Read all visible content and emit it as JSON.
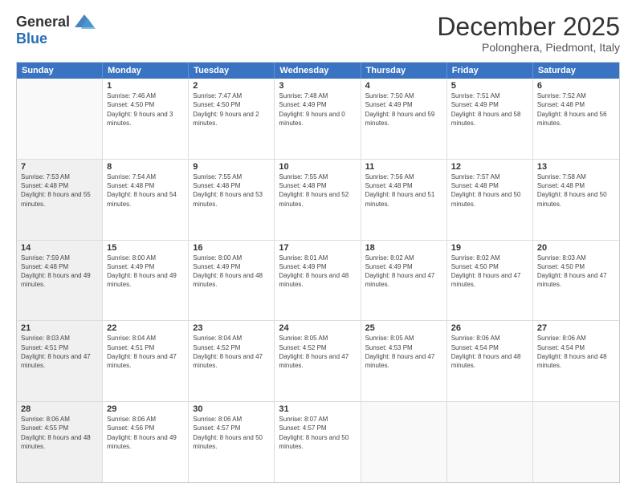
{
  "logo": {
    "general": "General",
    "blue": "Blue"
  },
  "header": {
    "month": "December 2025",
    "location": "Polonghera, Piedmont, Italy"
  },
  "days": [
    "Sunday",
    "Monday",
    "Tuesday",
    "Wednesday",
    "Thursday",
    "Friday",
    "Saturday"
  ],
  "weeks": [
    [
      {
        "day": "",
        "sunrise": "",
        "sunset": "",
        "daylight": "",
        "empty": true
      },
      {
        "day": "1",
        "sunrise": "Sunrise: 7:46 AM",
        "sunset": "Sunset: 4:50 PM",
        "daylight": "Daylight: 9 hours and 3 minutes."
      },
      {
        "day": "2",
        "sunrise": "Sunrise: 7:47 AM",
        "sunset": "Sunset: 4:50 PM",
        "daylight": "Daylight: 9 hours and 2 minutes."
      },
      {
        "day": "3",
        "sunrise": "Sunrise: 7:48 AM",
        "sunset": "Sunset: 4:49 PM",
        "daylight": "Daylight: 9 hours and 0 minutes."
      },
      {
        "day": "4",
        "sunrise": "Sunrise: 7:50 AM",
        "sunset": "Sunset: 4:49 PM",
        "daylight": "Daylight: 8 hours and 59 minutes."
      },
      {
        "day": "5",
        "sunrise": "Sunrise: 7:51 AM",
        "sunset": "Sunset: 4:49 PM",
        "daylight": "Daylight: 8 hours and 58 minutes."
      },
      {
        "day": "6",
        "sunrise": "Sunrise: 7:52 AM",
        "sunset": "Sunset: 4:48 PM",
        "daylight": "Daylight: 8 hours and 56 minutes."
      }
    ],
    [
      {
        "day": "7",
        "sunrise": "Sunrise: 7:53 AM",
        "sunset": "Sunset: 4:48 PM",
        "daylight": "Daylight: 8 hours and 55 minutes.",
        "shaded": true
      },
      {
        "day": "8",
        "sunrise": "Sunrise: 7:54 AM",
        "sunset": "Sunset: 4:48 PM",
        "daylight": "Daylight: 8 hours and 54 minutes."
      },
      {
        "day": "9",
        "sunrise": "Sunrise: 7:55 AM",
        "sunset": "Sunset: 4:48 PM",
        "daylight": "Daylight: 8 hours and 53 minutes."
      },
      {
        "day": "10",
        "sunrise": "Sunrise: 7:55 AM",
        "sunset": "Sunset: 4:48 PM",
        "daylight": "Daylight: 8 hours and 52 minutes."
      },
      {
        "day": "11",
        "sunrise": "Sunrise: 7:56 AM",
        "sunset": "Sunset: 4:48 PM",
        "daylight": "Daylight: 8 hours and 51 minutes."
      },
      {
        "day": "12",
        "sunrise": "Sunrise: 7:57 AM",
        "sunset": "Sunset: 4:48 PM",
        "daylight": "Daylight: 8 hours and 50 minutes."
      },
      {
        "day": "13",
        "sunrise": "Sunrise: 7:58 AM",
        "sunset": "Sunset: 4:48 PM",
        "daylight": "Daylight: 8 hours and 50 minutes."
      }
    ],
    [
      {
        "day": "14",
        "sunrise": "Sunrise: 7:59 AM",
        "sunset": "Sunset: 4:48 PM",
        "daylight": "Daylight: 8 hours and 49 minutes.",
        "shaded": true
      },
      {
        "day": "15",
        "sunrise": "Sunrise: 8:00 AM",
        "sunset": "Sunset: 4:49 PM",
        "daylight": "Daylight: 8 hours and 49 minutes."
      },
      {
        "day": "16",
        "sunrise": "Sunrise: 8:00 AM",
        "sunset": "Sunset: 4:49 PM",
        "daylight": "Daylight: 8 hours and 48 minutes."
      },
      {
        "day": "17",
        "sunrise": "Sunrise: 8:01 AM",
        "sunset": "Sunset: 4:49 PM",
        "daylight": "Daylight: 8 hours and 48 minutes."
      },
      {
        "day": "18",
        "sunrise": "Sunrise: 8:02 AM",
        "sunset": "Sunset: 4:49 PM",
        "daylight": "Daylight: 8 hours and 47 minutes."
      },
      {
        "day": "19",
        "sunrise": "Sunrise: 8:02 AM",
        "sunset": "Sunset: 4:50 PM",
        "daylight": "Daylight: 8 hours and 47 minutes."
      },
      {
        "day": "20",
        "sunrise": "Sunrise: 8:03 AM",
        "sunset": "Sunset: 4:50 PM",
        "daylight": "Daylight: 8 hours and 47 minutes."
      }
    ],
    [
      {
        "day": "21",
        "sunrise": "Sunrise: 8:03 AM",
        "sunset": "Sunset: 4:51 PM",
        "daylight": "Daylight: 8 hours and 47 minutes.",
        "shaded": true
      },
      {
        "day": "22",
        "sunrise": "Sunrise: 8:04 AM",
        "sunset": "Sunset: 4:51 PM",
        "daylight": "Daylight: 8 hours and 47 minutes."
      },
      {
        "day": "23",
        "sunrise": "Sunrise: 8:04 AM",
        "sunset": "Sunset: 4:52 PM",
        "daylight": "Daylight: 8 hours and 47 minutes."
      },
      {
        "day": "24",
        "sunrise": "Sunrise: 8:05 AM",
        "sunset": "Sunset: 4:52 PM",
        "daylight": "Daylight: 8 hours and 47 minutes."
      },
      {
        "day": "25",
        "sunrise": "Sunrise: 8:05 AM",
        "sunset": "Sunset: 4:53 PM",
        "daylight": "Daylight: 8 hours and 47 minutes."
      },
      {
        "day": "26",
        "sunrise": "Sunrise: 8:06 AM",
        "sunset": "Sunset: 4:54 PM",
        "daylight": "Daylight: 8 hours and 48 minutes."
      },
      {
        "day": "27",
        "sunrise": "Sunrise: 8:06 AM",
        "sunset": "Sunset: 4:54 PM",
        "daylight": "Daylight: 8 hours and 48 minutes."
      }
    ],
    [
      {
        "day": "28",
        "sunrise": "Sunrise: 8:06 AM",
        "sunset": "Sunset: 4:55 PM",
        "daylight": "Daylight: 8 hours and 48 minutes.",
        "shaded": true
      },
      {
        "day": "29",
        "sunrise": "Sunrise: 8:06 AM",
        "sunset": "Sunset: 4:56 PM",
        "daylight": "Daylight: 8 hours and 49 minutes."
      },
      {
        "day": "30",
        "sunrise": "Sunrise: 8:06 AM",
        "sunset": "Sunset: 4:57 PM",
        "daylight": "Daylight: 8 hours and 50 minutes."
      },
      {
        "day": "31",
        "sunrise": "Sunrise: 8:07 AM",
        "sunset": "Sunset: 4:57 PM",
        "daylight": "Daylight: 8 hours and 50 minutes."
      },
      {
        "day": "",
        "sunrise": "",
        "sunset": "",
        "daylight": "",
        "empty": true
      },
      {
        "day": "",
        "sunrise": "",
        "sunset": "",
        "daylight": "",
        "empty": true
      },
      {
        "day": "",
        "sunrise": "",
        "sunset": "",
        "daylight": "",
        "empty": true
      }
    ]
  ]
}
